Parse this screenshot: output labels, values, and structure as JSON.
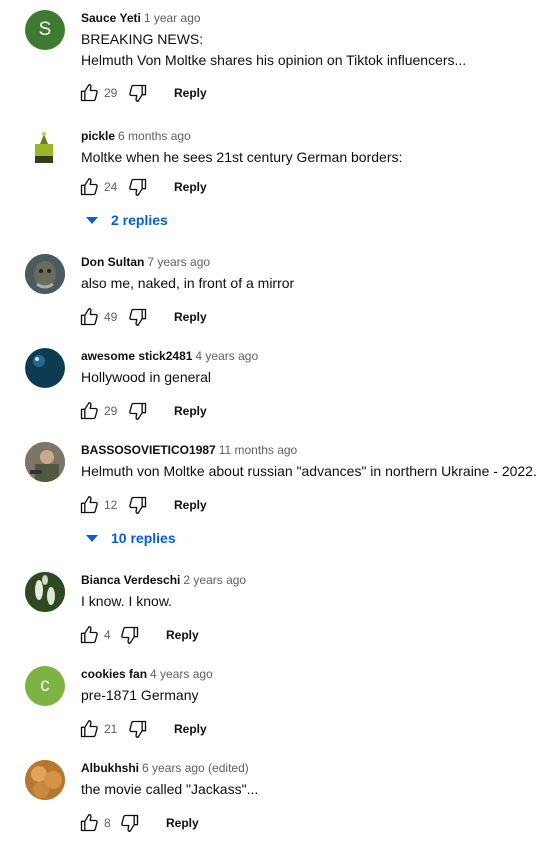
{
  "comments": [
    {
      "author": "Sauce Yeti",
      "time": "1 year ago",
      "text": "BREAKING NEWS:\nHelmuth Von Moltke shares his opinion on Tiktok influencers...",
      "likes": "29",
      "reply": "Reply",
      "avatar_letter": "S",
      "avatar_color": "#3e7a2f"
    },
    {
      "author": "pickle",
      "time": "6 months ago",
      "text": "Moltke when he sees 21st century German borders:",
      "likes": "24",
      "reply": "Reply",
      "replies": "2 replies"
    },
    {
      "author": "Don Sultan",
      "time": "7 years ago",
      "text": "also me, naked, in front of a mirror",
      "likes": "49",
      "reply": "Reply"
    },
    {
      "author": "awesome stick2481",
      "time": "4 years ago",
      "text": "Hollywood in general",
      "likes": "29",
      "reply": "Reply"
    },
    {
      "author": "BASSOSOVIETICO1987",
      "time": "11 months ago",
      "text": "Helmuth von Moltke about russian \"advances\" in northern Ukraine - 2022.",
      "likes": "12",
      "reply": "Reply",
      "replies": "10 replies"
    },
    {
      "author": "Bianca Verdeschi",
      "time": "2 years ago",
      "text": "I know. I know.",
      "likes": "4",
      "reply": "Reply"
    },
    {
      "author": "cookies fan",
      "time": "4 years ago",
      "text": "pre-1871 Germany",
      "likes": "21",
      "reply": "Reply",
      "avatar_letter": "c",
      "avatar_color": "#7cb342"
    },
    {
      "author": "Albukhshi",
      "time": "6 years ago (edited)",
      "text": "the movie called \"Jackass\"...",
      "likes": "8",
      "reply": "Reply"
    }
  ]
}
